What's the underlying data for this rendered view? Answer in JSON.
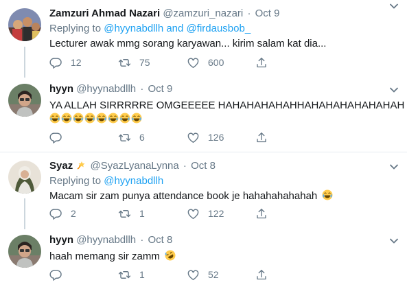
{
  "tweets": [
    {
      "name": "Zamzuri Ahmad Nazari",
      "handle": "@zamzuri_nazari",
      "dot": "·",
      "date": "Oct 9",
      "replying_prefix": "Replying to",
      "replying_to_1": "@hyynabdllh",
      "replying_and": "and",
      "replying_to_2": "@firdausbob_",
      "text": "Lecturer awak mmg sorang karyawan... kirim salam kat dia...",
      "reply_count": "12",
      "retweet_count": "75",
      "like_count": "600"
    },
    {
      "name": "hyyn",
      "handle": "@hyynabdllh",
      "dot": "·",
      "date": "Oct 9",
      "text": "YA ALLAH SIRRRRRE OMGEEEEE HAHAHAHAHAHHAHAHAHAHAHAHAH",
      "reply_count": "",
      "retweet_count": "6",
      "like_count": "126"
    },
    {
      "name": "Syaz",
      "handle": "@SyazLyanaLynna",
      "dot": "·",
      "date": "Oct 8",
      "replying_prefix": "Replying to",
      "replying_to_1": "@hyynabdllh",
      "text": "Macam sir zam punya attendance book je hahahahahahah",
      "reply_count": "2",
      "retweet_count": "1",
      "like_count": "122"
    },
    {
      "name": "hyyn",
      "handle": "@hyynabdllh",
      "dot": "·",
      "date": "Oct 8",
      "text": "haah memang sir zamm",
      "reply_count": "",
      "retweet_count": "1",
      "like_count": "52"
    }
  ],
  "icons": {
    "reply": "reply-icon",
    "retweet": "retweet-icon",
    "like": "like-icon",
    "share": "share-icon",
    "more": "chevron-down-icon",
    "laugh_emoji": "face-with-tears-of-joy-emoji",
    "rofl_emoji": "rolling-on-floor-laughing-emoji",
    "dizzy_emoji": "dizzy-emoji"
  },
  "colors": {
    "link": "#1da1f2",
    "muted": "#657786",
    "divider": "#e6ecf0",
    "thread_line": "#ccd6dd"
  }
}
